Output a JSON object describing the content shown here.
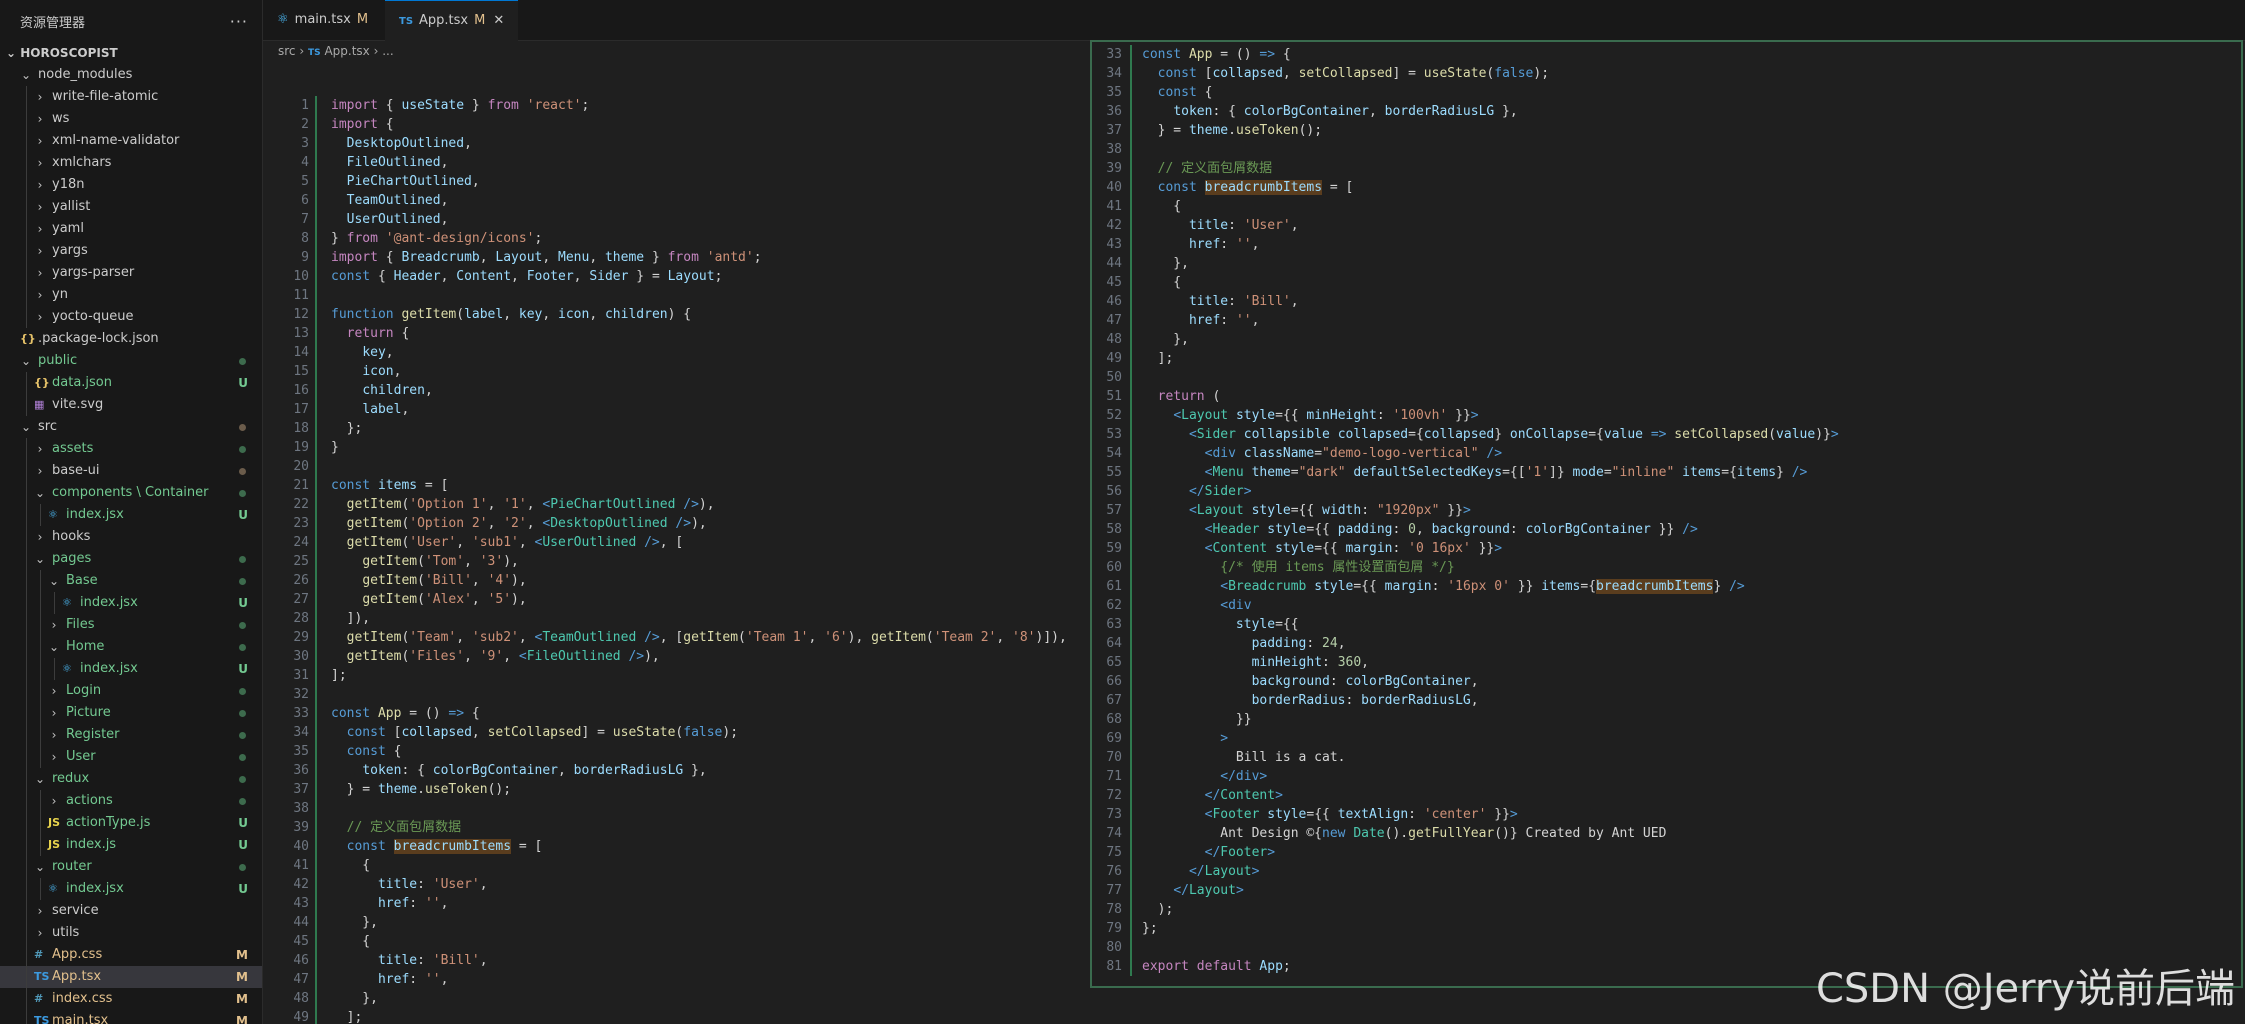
{
  "explorer": {
    "title": "资源管理器",
    "more": "···",
    "project": "HOROSCOPIST",
    "items": [
      {
        "label": "node_modules",
        "depth": 1,
        "type": "folder",
        "open": true
      },
      {
        "label": "write-file-atomic",
        "depth": 2,
        "type": "folder",
        "open": false
      },
      {
        "label": "ws",
        "depth": 2,
        "type": "folder",
        "open": false
      },
      {
        "label": "xml-name-validator",
        "depth": 2,
        "type": "folder",
        "open": false
      },
      {
        "label": "xmlchars",
        "depth": 2,
        "type": "folder",
        "open": false
      },
      {
        "label": "y18n",
        "depth": 2,
        "type": "folder",
        "open": false
      },
      {
        "label": "yallist",
        "depth": 2,
        "type": "folder",
        "open": false
      },
      {
        "label": "yaml",
        "depth": 2,
        "type": "folder",
        "open": false
      },
      {
        "label": "yargs",
        "depth": 2,
        "type": "folder",
        "open": false
      },
      {
        "label": "yargs-parser",
        "depth": 2,
        "type": "folder",
        "open": false
      },
      {
        "label": "yn",
        "depth": 2,
        "type": "folder",
        "open": false
      },
      {
        "label": "yocto-queue",
        "depth": 2,
        "type": "folder",
        "open": false
      },
      {
        "label": ".package-lock.json",
        "depth": 1,
        "type": "json"
      },
      {
        "label": "public",
        "depth": 1,
        "type": "folder",
        "open": true,
        "color": "#73c991",
        "dot": true
      },
      {
        "label": "data.json",
        "depth": 2,
        "type": "json",
        "color": "#73c991",
        "badge": "U"
      },
      {
        "label": "vite.svg",
        "depth": 2,
        "type": "svg"
      },
      {
        "label": "src",
        "depth": 1,
        "type": "folder",
        "open": true,
        "dot": true
      },
      {
        "label": "assets",
        "depth": 2,
        "type": "folder",
        "open": false,
        "color": "#73c991",
        "dot": true
      },
      {
        "label": "base-ui",
        "depth": 2,
        "type": "folder",
        "open": false,
        "dot": true
      },
      {
        "label": "components \\ Container",
        "depth": 2,
        "type": "folder",
        "open": true,
        "color": "#73c991",
        "dot": true
      },
      {
        "label": "index.jsx",
        "depth": 3,
        "type": "react",
        "color": "#73c991",
        "badge": "U"
      },
      {
        "label": "hooks",
        "depth": 2,
        "type": "folder",
        "open": false
      },
      {
        "label": "pages",
        "depth": 2,
        "type": "folder",
        "open": true,
        "color": "#73c991",
        "dot": true
      },
      {
        "label": "Base",
        "depth": 3,
        "type": "folder",
        "open": true,
        "color": "#73c991",
        "dot": true
      },
      {
        "label": "index.jsx",
        "depth": 4,
        "type": "react",
        "color": "#73c991",
        "badge": "U"
      },
      {
        "label": "Files",
        "depth": 3,
        "type": "folder",
        "open": false,
        "color": "#73c991",
        "dot": true
      },
      {
        "label": "Home",
        "depth": 3,
        "type": "folder",
        "open": true,
        "color": "#73c991",
        "dot": true
      },
      {
        "label": "index.jsx",
        "depth": 4,
        "type": "react",
        "color": "#73c991",
        "badge": "U"
      },
      {
        "label": "Login",
        "depth": 3,
        "type": "folder",
        "open": false,
        "color": "#73c991",
        "dot": true
      },
      {
        "label": "Picture",
        "depth": 3,
        "type": "folder",
        "open": false,
        "color": "#73c991",
        "dot": true
      },
      {
        "label": "Register",
        "depth": 3,
        "type": "folder",
        "open": false,
        "color": "#73c991",
        "dot": true
      },
      {
        "label": "User",
        "depth": 3,
        "type": "folder",
        "open": false,
        "color": "#73c991",
        "dot": true
      },
      {
        "label": "redux",
        "depth": 2,
        "type": "folder",
        "open": true,
        "color": "#73c991",
        "dot": true
      },
      {
        "label": "actions",
        "depth": 3,
        "type": "folder",
        "open": false,
        "color": "#73c991",
        "dot": true
      },
      {
        "label": "actionType.js",
        "depth": 3,
        "type": "js",
        "color": "#73c991",
        "badge": "U"
      },
      {
        "label": "index.js",
        "depth": 3,
        "type": "js",
        "color": "#73c991",
        "badge": "U"
      },
      {
        "label": "router",
        "depth": 2,
        "type": "folder",
        "open": true,
        "color": "#73c991",
        "dot": true
      },
      {
        "label": "index.jsx",
        "depth": 3,
        "type": "react",
        "color": "#73c991",
        "badge": "U"
      },
      {
        "label": "service",
        "depth": 2,
        "type": "folder",
        "open": false
      },
      {
        "label": "utils",
        "depth": 2,
        "type": "folder",
        "open": false
      },
      {
        "label": "App.css",
        "depth": 2,
        "type": "css",
        "color": "#e2c08d",
        "badge": "M"
      },
      {
        "label": "App.tsx",
        "depth": 2,
        "type": "ts",
        "color": "#e2c08d",
        "badge": "M",
        "selected": true
      },
      {
        "label": "index.css",
        "depth": 2,
        "type": "css",
        "color": "#e2c08d",
        "badge": "M"
      },
      {
        "label": "main.tsx",
        "depth": 2,
        "type": "ts",
        "color": "#e2c08d",
        "badge": "M"
      }
    ]
  },
  "tabs": [
    {
      "label": "main.tsx",
      "icon": "react",
      "status": "M",
      "active": false
    },
    {
      "label": "App.tsx",
      "icon": "TS",
      "status": "M",
      "active": true,
      "close": "✕"
    }
  ],
  "breadcrumb": {
    "src": "src",
    "sep": "›",
    "ts": "TS",
    "file": "App.tsx",
    "more": "› ..."
  },
  "left_lines": [
    {
      "n": "1",
      "code": "<span class='k'>import</span> { <span class='v'>useState</span> } <span class='k'>from</span> <span class='s'>'react'</span>;"
    },
    {
      "n": "2",
      "code": "<span class='k'>import</span> {"
    },
    {
      "n": "3",
      "code": "  <span class='v'>DesktopOutlined</span>,"
    },
    {
      "n": "4",
      "code": "  <span class='v'>FileOutlined</span>,"
    },
    {
      "n": "5",
      "code": "  <span class='v'>PieChartOutlined</span>,"
    },
    {
      "n": "6",
      "code": "  <span class='v'>TeamOutlined</span>,"
    },
    {
      "n": "7",
      "code": "  <span class='v'>UserOutlined</span>,"
    },
    {
      "n": "8",
      "code": "} <span class='k'>from</span> <span class='s'>'@ant-design/icons'</span>;"
    },
    {
      "n": "9",
      "code": "<span class='k'>import</span> { <span class='v'>Breadcrumb</span>, <span class='v'>Layout</span>, <span class='v'>Menu</span>, <span class='v'>theme</span> } <span class='k'>from</span> <span class='s'>'antd'</span>;"
    },
    {
      "n": "10",
      "code": "<span class='b'>const</span> { <span class='v'>Header</span>, <span class='v'>Content</span>, <span class='v'>Footer</span>, <span class='v'>Sider</span> } = <span class='v'>Layout</span>;"
    },
    {
      "n": "11",
      "code": ""
    },
    {
      "n": "12",
      "code": "<span class='b'>function</span> <span class='f'>getItem</span>(<span class='v'>label</span>, <span class='v'>key</span>, <span class='v'>icon</span>, <span class='v'>children</span>) {"
    },
    {
      "n": "13",
      "code": "  <span class='k'>return</span> {"
    },
    {
      "n": "14",
      "code": "    <span class='v'>key</span>,"
    },
    {
      "n": "15",
      "code": "    <span class='v'>icon</span>,"
    },
    {
      "n": "16",
      "code": "    <span class='v'>children</span>,"
    },
    {
      "n": "17",
      "code": "    <span class='v'>label</span>,"
    },
    {
      "n": "18",
      "code": "  };"
    },
    {
      "n": "19",
      "code": "}"
    },
    {
      "n": "20",
      "code": ""
    },
    {
      "n": "21",
      "code": "<span class='b'>const</span> <span class='v'>items</span> = ["
    },
    {
      "n": "22",
      "code": "  <span class='f'>getItem</span>(<span class='s'>'Option 1'</span>, <span class='s'>'1'</span>, <span class='b'>&lt;</span><span class='t'>PieChartOutlined</span> <span class='b'>/&gt;</span>),"
    },
    {
      "n": "23",
      "code": "  <span class='f'>getItem</span>(<span class='s'>'Option 2'</span>, <span class='s'>'2'</span>, <span class='b'>&lt;</span><span class='t'>DesktopOutlined</span> <span class='b'>/&gt;</span>),"
    },
    {
      "n": "24",
      "code": "  <span class='f'>getItem</span>(<span class='s'>'User'</span>, <span class='s'>'sub1'</span>, <span class='b'>&lt;</span><span class='t'>UserOutlined</span> <span class='b'>/&gt;</span>, ["
    },
    {
      "n": "25",
      "code": "    <span class='f'>getItem</span>(<span class='s'>'Tom'</span>, <span class='s'>'3'</span>),"
    },
    {
      "n": "26",
      "code": "    <span class='f'>getItem</span>(<span class='s'>'Bill'</span>, <span class='s'>'4'</span>),"
    },
    {
      "n": "27",
      "code": "    <span class='f'>getItem</span>(<span class='s'>'Alex'</span>, <span class='s'>'5'</span>),"
    },
    {
      "n": "28",
      "code": "  ]),"
    },
    {
      "n": "29",
      "code": "  <span class='f'>getItem</span>(<span class='s'>'Team'</span>, <span class='s'>'sub2'</span>, <span class='b'>&lt;</span><span class='t'>TeamOutlined</span> <span class='b'>/&gt;</span>, [<span class='f'>getItem</span>(<span class='s'>'Team 1'</span>, <span class='s'>'6'</span>), <span class='f'>getItem</span>(<span class='s'>'Team 2'</span>, <span class='s'>'8'</span>)]),"
    },
    {
      "n": "30",
      "code": "  <span class='f'>getItem</span>(<span class='s'>'Files'</span>, <span class='s'>'9'</span>, <span class='b'>&lt;</span><span class='t'>FileOutlined</span> <span class='b'>/&gt;</span>),"
    },
    {
      "n": "31",
      "code": "];"
    },
    {
      "n": "32",
      "code": ""
    },
    {
      "n": "33",
      "code": "<span class='b'>const</span> <span class='f'>App</span> = () <span class='b'>=&gt;</span> {"
    },
    {
      "n": "34",
      "code": "  <span class='b'>const</span> [<span class='v'>collapsed</span>, <span class='f'>setCollapsed</span>] = <span class='f'>useState</span>(<span class='b'>false</span>);"
    },
    {
      "n": "35",
      "code": "  <span class='b'>const</span> {"
    },
    {
      "n": "36",
      "code": "    <span class='v'>token</span>: { <span class='v'>colorBgContainer</span>, <span class='v'>borderRadiusLG</span> },"
    },
    {
      "n": "37",
      "code": "  } = <span class='v'>theme</span>.<span class='f'>useToken</span>();"
    },
    {
      "n": "38",
      "code": ""
    },
    {
      "n": "39",
      "code": "  <span class='c'>// 定义面包屑数据</span>"
    },
    {
      "n": "40",
      "code": "  <span class='b'>const</span> <span class='v hl'>breadcrumbItems</span> = ["
    },
    {
      "n": "41",
      "code": "    {"
    },
    {
      "n": "42",
      "code": "      <span class='v'>title</span>: <span class='s'>'User'</span>,"
    },
    {
      "n": "43",
      "code": "      <span class='v'>href</span>: <span class='s'>''</span>,"
    },
    {
      "n": "44",
      "code": "    },"
    },
    {
      "n": "45",
      "code": "    {"
    },
    {
      "n": "46",
      "code": "      <span class='v'>title</span>: <span class='s'>'Bill'</span>,"
    },
    {
      "n": "47",
      "code": "      <span class='v'>href</span>: <span class='s'>''</span>,"
    },
    {
      "n": "48",
      "code": "    },"
    },
    {
      "n": "49",
      "code": "  ];"
    }
  ],
  "right_lines": [
    {
      "n": "33",
      "code": "<span class='b'>const</span> <span class='f'>App</span> = () <span class='b'>=&gt;</span> {"
    },
    {
      "n": "34",
      "code": "  <span class='b'>const</span> [<span class='v'>collapsed</span>, <span class='f'>setCollapsed</span>] = <span class='f'>useState</span>(<span class='b'>false</span>);"
    },
    {
      "n": "35",
      "code": "  <span class='b'>const</span> {"
    },
    {
      "n": "36",
      "code": "    <span class='v'>token</span>: { <span class='v'>colorBgContainer</span>, <span class='v'>borderRadiusLG</span> },"
    },
    {
      "n": "37",
      "code": "  } = <span class='v'>theme</span>.<span class='f'>useToken</span>();"
    },
    {
      "n": "38",
      "code": ""
    },
    {
      "n": "39",
      "code": "  <span class='c'>// 定义面包屑数据</span>"
    },
    {
      "n": "40",
      "code": "  <span class='b'>const</span> <span class='v hl'>breadcrumbItems</span> = ["
    },
    {
      "n": "41",
      "code": "    {"
    },
    {
      "n": "42",
      "code": "      <span class='v'>title</span>: <span class='s'>'User'</span>,"
    },
    {
      "n": "43",
      "code": "      <span class='v'>href</span>: <span class='s'>''</span>,"
    },
    {
      "n": "44",
      "code": "    },"
    },
    {
      "n": "45",
      "code": "    {"
    },
    {
      "n": "46",
      "code": "      <span class='v'>title</span>: <span class='s'>'Bill'</span>,"
    },
    {
      "n": "47",
      "code": "      <span class='v'>href</span>: <span class='s'>''</span>,"
    },
    {
      "n": "48",
      "code": "    },"
    },
    {
      "n": "49",
      "code": "  ];"
    },
    {
      "n": "50",
      "code": ""
    },
    {
      "n": "51",
      "code": "  <span class='k'>return</span> ("
    },
    {
      "n": "52",
      "code": "    <span class='b'>&lt;</span><span class='t'>Layout</span> <span class='v'>style</span>={{ <span class='v'>minHeight</span>: <span class='s'>'100vh'</span> }}<span class='b'>&gt;</span>"
    },
    {
      "n": "53",
      "code": "      <span class='b'>&lt;</span><span class='t'>Sider</span> <span class='v'>collapsible</span> <span class='v'>collapsed</span>={<span class='v'>collapsed</span>} <span class='v'>onCollapse</span>={<span class='v'>value</span> <span class='b'>=&gt;</span> <span class='f'>setCollapsed</span>(<span class='v'>value</span>)}<span class='b'>&gt;</span>"
    },
    {
      "n": "54",
      "code": "        <span class='b'>&lt;div</span> <span class='v'>className</span>=<span class='s'>\"demo-logo-vertical\"</span> <span class='b'>/&gt;</span>"
    },
    {
      "n": "55",
      "code": "        <span class='b'>&lt;</span><span class='t'>Menu</span> <span class='v'>theme</span>=<span class='s'>\"dark\"</span> <span class='v'>defaultSelectedKeys</span>={[<span class='s'>'1'</span>]} <span class='v'>mode</span>=<span class='s'>\"inline\"</span> <span class='v'>items</span>={<span class='v'>items</span>} <span class='b'>/&gt;</span>"
    },
    {
      "n": "56",
      "code": "      <span class='b'>&lt;/</span><span class='t'>Sider</span><span class='b'>&gt;</span>"
    },
    {
      "n": "57",
      "code": "      <span class='b'>&lt;</span><span class='t'>Layout</span> <span class='v'>style</span>={{ <span class='v'>width</span>: <span class='s'>\"1920px\"</span> }}<span class='b'>&gt;</span>"
    },
    {
      "n": "58",
      "code": "        <span class='b'>&lt;</span><span class='t'>Header</span> <span class='v'>style</span>={{ <span class='v'>padding</span>: <span class='n'>0</span>, <span class='v'>background</span>: <span class='v'>colorBgContainer</span> }} <span class='b'>/&gt;</span>"
    },
    {
      "n": "59",
      "code": "        <span class='b'>&lt;</span><span class='t'>Content</span> <span class='v'>style</span>={{ <span class='v'>margin</span>: <span class='s'>'0 16px'</span> }}<span class='b'>&gt;</span>"
    },
    {
      "n": "60",
      "code": "          <span class='c'>{/* 使用 items 属性设置面包屑 */}</span>"
    },
    {
      "n": "61",
      "code": "          <span class='b'>&lt;</span><span class='t'>Breadcrumb</span> <span class='v'>style</span>={{ <span class='v'>margin</span>: <span class='s'>'16px 0'</span> }} <span class='v'>items</span>={<span class='v hl'>breadcrumbItems</span>} <span class='b'>/&gt;</span>"
    },
    {
      "n": "62",
      "code": "          <span class='b'>&lt;div</span>"
    },
    {
      "n": "63",
      "code": "            <span class='v'>style</span>={{"
    },
    {
      "n": "64",
      "code": "              <span class='v'>padding</span>: <span class='n'>24</span>,"
    },
    {
      "n": "65",
      "code": "              <span class='v'>minHeight</span>: <span class='n'>360</span>,"
    },
    {
      "n": "66",
      "code": "              <span class='v'>background</span>: <span class='v'>colorBgContainer</span>,"
    },
    {
      "n": "67",
      "code": "              <span class='v'>borderRadius</span>: <span class='v'>borderRadiusLG</span>,"
    },
    {
      "n": "68",
      "code": "            }}"
    },
    {
      "n": "69",
      "code": "          <span class='b'>&gt;</span>"
    },
    {
      "n": "70",
      "code": "            Bill is a cat."
    },
    {
      "n": "71",
      "code": "          <span class='b'>&lt;/div&gt;</span>"
    },
    {
      "n": "72",
      "code": "        <span class='b'>&lt;/</span><span class='t'>Content</span><span class='b'>&gt;</span>"
    },
    {
      "n": "73",
      "code": "        <span class='b'>&lt;</span><span class='t'>Footer</span> <span class='v'>style</span>={{ <span class='v'>textAlign</span>: <span class='s'>'center'</span> }}<span class='b'>&gt;</span>"
    },
    {
      "n": "74",
      "code": "          Ant Design ©{<span class='b'>new</span> <span class='t'>Date</span>().<span class='f'>getFullYear</span>()} Created by Ant UED"
    },
    {
      "n": "75",
      "code": "        <span class='b'>&lt;/</span><span class='t'>Footer</span><span class='b'>&gt;</span>"
    },
    {
      "n": "76",
      "code": "      <span class='b'>&lt;/</span><span class='t'>Layout</span><span class='b'>&gt;</span>"
    },
    {
      "n": "77",
      "code": "    <span class='b'>&lt;/</span><span class='t'>Layout</span><span class='b'>&gt;</span>"
    },
    {
      "n": "78",
      "code": "  );"
    },
    {
      "n": "79",
      "code": "};"
    },
    {
      "n": "80",
      "code": ""
    },
    {
      "n": "81",
      "code": "<span class='k'>export</span> <span class='k'>default</span> <span class='v'>App</span>;"
    }
  ],
  "watermark": "CSDN @Jerry说前后端",
  "colors": {
    "untracked": "#73c991",
    "modified": "#e2c08d",
    "accent": "#0078d4",
    "split_border": "#3a6b4e"
  }
}
